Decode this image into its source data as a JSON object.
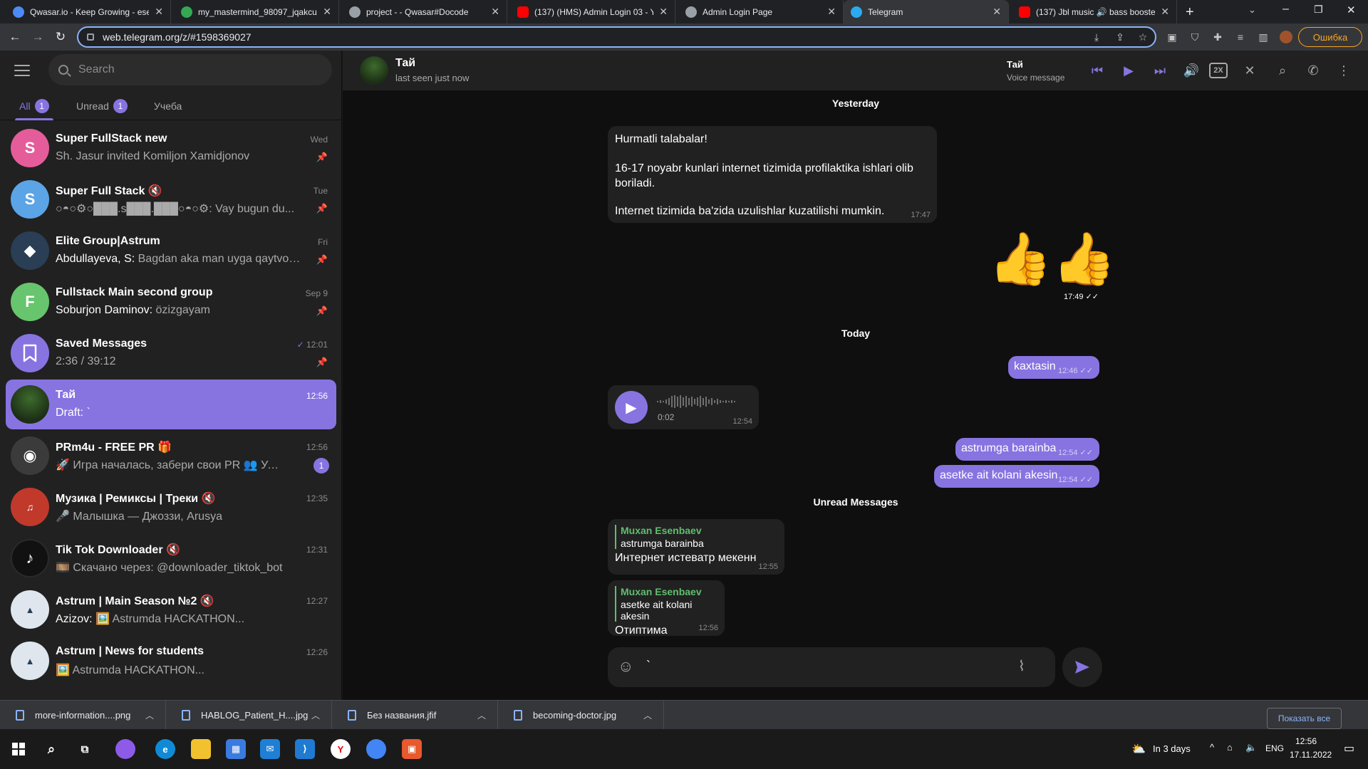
{
  "browser": {
    "tabs": [
      {
        "title": "Qwasar.io - Keep Growing - ese",
        "color": "#4c8bf5"
      },
      {
        "title": "my_mastermind_98097_jqakcu/",
        "color": "#34a853"
      },
      {
        "title": "project - - Qwasar#Docode",
        "color": "#9aa0a6"
      },
      {
        "title": "(137) (HMS) Admin Login 03 - Y",
        "color": "#ff0000"
      },
      {
        "title": "Admin Login Page",
        "color": "#9aa0a6"
      },
      {
        "title": "Telegram",
        "color": "#2aabee"
      },
      {
        "title": "(137) Jbl music 🔊 bass booste",
        "color": "#ff0000"
      }
    ],
    "url": "web.telegram.org/z/#1598369027",
    "error_label": "Ошибка"
  },
  "sidebar": {
    "search_placeholder": "Search",
    "folders": [
      {
        "label": "All",
        "count": "1"
      },
      {
        "label": "Unread",
        "count": "1"
      },
      {
        "label": "Учеба"
      }
    ],
    "chats": [
      {
        "name": "Super FullStack new",
        "time": "Wed",
        "sender": "",
        "preview": "Sh. Jasur invited Komiljon Xamidjonov",
        "avatar": "S",
        "color": "#e45c9a",
        "pinned": true
      },
      {
        "name": "Super Full Stack 🔇",
        "time": "Tue",
        "sender": "",
        "preview": "○◓○⚙○███.s███.███○◓○⚙: Vay bugun du...",
        "avatar": "S",
        "color": "#5ba4e6",
        "pinned": true
      },
      {
        "name": "Elite Group|Astrum",
        "time": "Fri",
        "sender": "Abdullayeva, S: ",
        "preview": "Bagdan aka man uyga qaytvom...",
        "avatar": "",
        "color": "#2a3e55",
        "pinned": true
      },
      {
        "name": "Fullstack Main second group",
        "time": "Sep 9",
        "sender": "Soburjon Daminov: ",
        "preview": "özizgayam",
        "avatar": "F",
        "color": "#67c56d",
        "pinned": true
      },
      {
        "name": "Saved Messages",
        "time": "12:01",
        "sender": "",
        "preview": "2:36 / 39:12",
        "avatar": "🔖",
        "color": "#8774e1",
        "pinned": true
      },
      {
        "name": "Тай",
        "time": "12:56",
        "sender": "",
        "preview": "Draft: `",
        "avatar": "",
        "color": "#3d6b2d",
        "pinned": false
      },
      {
        "name": "PRm4u - FREE PR 🎁",
        "time": "12:56",
        "sender": "",
        "preview": "🚀 Игра началась, забери свои PR 👥 Успели с...",
        "avatar": "",
        "color": "#3b3b3b",
        "pinned": false,
        "badge": "1"
      },
      {
        "name": "Музика | Ремиксы | Треки 🔇",
        "time": "12:35",
        "sender": "",
        "preview": "🎤 Малышка — Джоззи, Arusya",
        "avatar": "",
        "color": "#c0392b",
        "pinned": false
      },
      {
        "name": "Tik Tok Downloader 🔇",
        "time": "12:31",
        "sender": "",
        "preview": "🎞️ Скачано через: @downloader_tiktok_bot",
        "avatar": "",
        "color": "#111111",
        "pinned": false
      },
      {
        "name": "Astrum | Main Season №2 🔇",
        "time": "12:27",
        "sender": "Azizov: ",
        "preview": "🖼️ Astrumda HACKATHON...",
        "avatar": "",
        "color": "#dfe6ee",
        "pinned": false
      },
      {
        "name": "Astrum | News for students",
        "time": "12:26",
        "sender": "",
        "preview": "🖼️ Astrumda HACKATHON...",
        "avatar": "",
        "color": "#dfe6ee",
        "pinned": false
      }
    ]
  },
  "header": {
    "name": "Тай",
    "status": "last seen just now",
    "player_title": "Тай",
    "player_sub": "Voice message",
    "speed": "2X"
  },
  "messages": {
    "yesterday": "Yesterday",
    "today": "Today",
    "unread": "Unread Messages",
    "announce": {
      "line1": "Hurmatli talabalar!",
      "line2": "16-17 noyabr kunlari internet tizimida profilaktika ishlari olib boriladi.",
      "line3": "Internet tizimida ba'zida uzulishlar kuzatilishi mumkin.",
      "time": "17:47"
    },
    "sticker": {
      "emoji": "👍👍",
      "time": "17:49"
    },
    "out1": {
      "text": "kaxtasin",
      "time": "12:46"
    },
    "voice": {
      "duration": "0:02",
      "time": "12:54"
    },
    "out2": {
      "text": "astrumga barainba",
      "time": "12:54"
    },
    "out3": {
      "text": "asetke ait kolani akesin",
      "time": "12:54"
    },
    "in1": {
      "reply_name": "Muxan Esenbaev",
      "reply_text": "astrumga barainba",
      "text": "Интернет истеватр мекенн",
      "time": "12:55"
    },
    "in2": {
      "reply_name": "Muxan Esenbaev",
      "reply_text": "asetke ait kolani akesin",
      "text": "Отиптима",
      "time": "12:56"
    },
    "composer_value": "`"
  },
  "downloads": {
    "items": [
      "more-information....png",
      "HABLOG_Patient_H....jpg",
      "Без названия.jfif",
      "becoming-doctor.jpg"
    ],
    "show_all": "Показать все"
  },
  "taskbar": {
    "weather": "In 3 days",
    "lang": "ENG",
    "time": "12:56",
    "date": "17.11.2022"
  }
}
